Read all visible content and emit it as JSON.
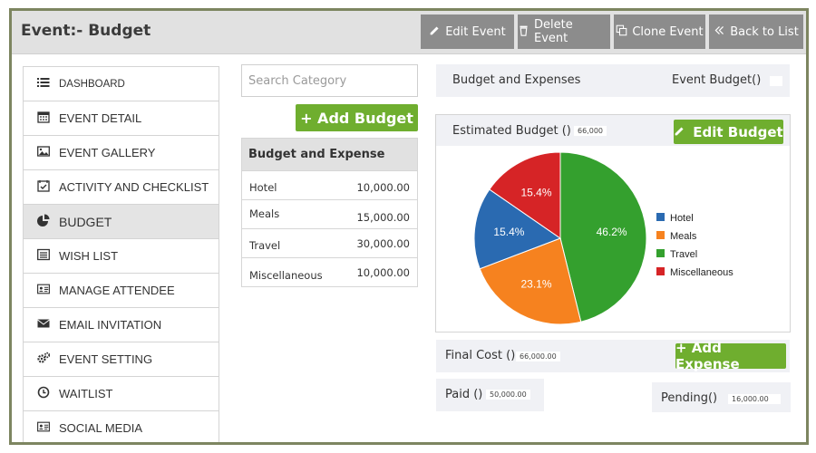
{
  "header": {
    "title": "Event:- Budget",
    "buttons": {
      "edit": "Edit Event",
      "delete": "Delete Event",
      "clone": "Clone Event",
      "back": "Back to List"
    }
  },
  "sidebar": {
    "items": [
      {
        "label": "DASHBOARD",
        "icon": "list-icon"
      },
      {
        "label": "EVENT DETAIL",
        "icon": "calendar-icon"
      },
      {
        "label": "EVENT GALLERY",
        "icon": "image-icon"
      },
      {
        "label": "ACTIVITY AND CHECKLIST",
        "icon": "calendar-check-icon"
      },
      {
        "label": "BUDGET",
        "icon": "pie-chart-icon",
        "active": true
      },
      {
        "label": "WISH LIST",
        "icon": "list-alt-icon"
      },
      {
        "label": "MANAGE ATTENDEE",
        "icon": "id-card-icon"
      },
      {
        "label": "EMAIL INVITATION",
        "icon": "envelope-icon"
      },
      {
        "label": "EVENT SETTING",
        "icon": "gears-icon"
      },
      {
        "label": "WAITLIST",
        "icon": "clock-icon"
      },
      {
        "label": "SOCIAL MEDIA",
        "icon": "id-card-icon"
      }
    ]
  },
  "category": {
    "search_placeholder": "Search Category",
    "add_budget_label": "+ Add Budget",
    "table_title": "Budget and Expense",
    "rows": [
      {
        "name": "Hotel",
        "value": "10,000.00"
      },
      {
        "name": "Meals",
        "value": "15,000.00"
      },
      {
        "name": "Travel",
        "value": "30,000.00"
      },
      {
        "name": "Miscellaneous",
        "value": "10,000.00"
      }
    ]
  },
  "summary": {
    "section_label": "Budget and Expenses",
    "event_budget_label": "Event Budget()",
    "event_budget_value": "",
    "estimated_label": "Estimated Budget ()",
    "estimated_value": "66,000",
    "edit_budget_label": "Edit Budget",
    "final_cost_label": "Final Cost ()",
    "final_cost_value": "66,000.00",
    "add_expense_label": "+ Add Expense",
    "paid_label": "Paid ()",
    "paid_value": "50,000.00",
    "pending_label": "Pending()",
    "pending_value": "16,000.00"
  },
  "chart_data": {
    "type": "pie",
    "categories": [
      "Hotel",
      "Meals",
      "Travel",
      "Miscellaneous"
    ],
    "values": [
      10000,
      15000,
      30000,
      10000
    ],
    "labels": [
      "15.4%",
      "23.1%",
      "46.2%",
      "15.4%"
    ],
    "colors": [
      "#2a6ab1",
      "#f6821f",
      "#34a02e",
      "#d62426"
    ],
    "legend": "right"
  },
  "colors": {
    "accent_green": "#6fae2f",
    "header_bg": "#e1e1e1",
    "button_gray": "#8c8c8c",
    "frame": "#7d8560"
  }
}
